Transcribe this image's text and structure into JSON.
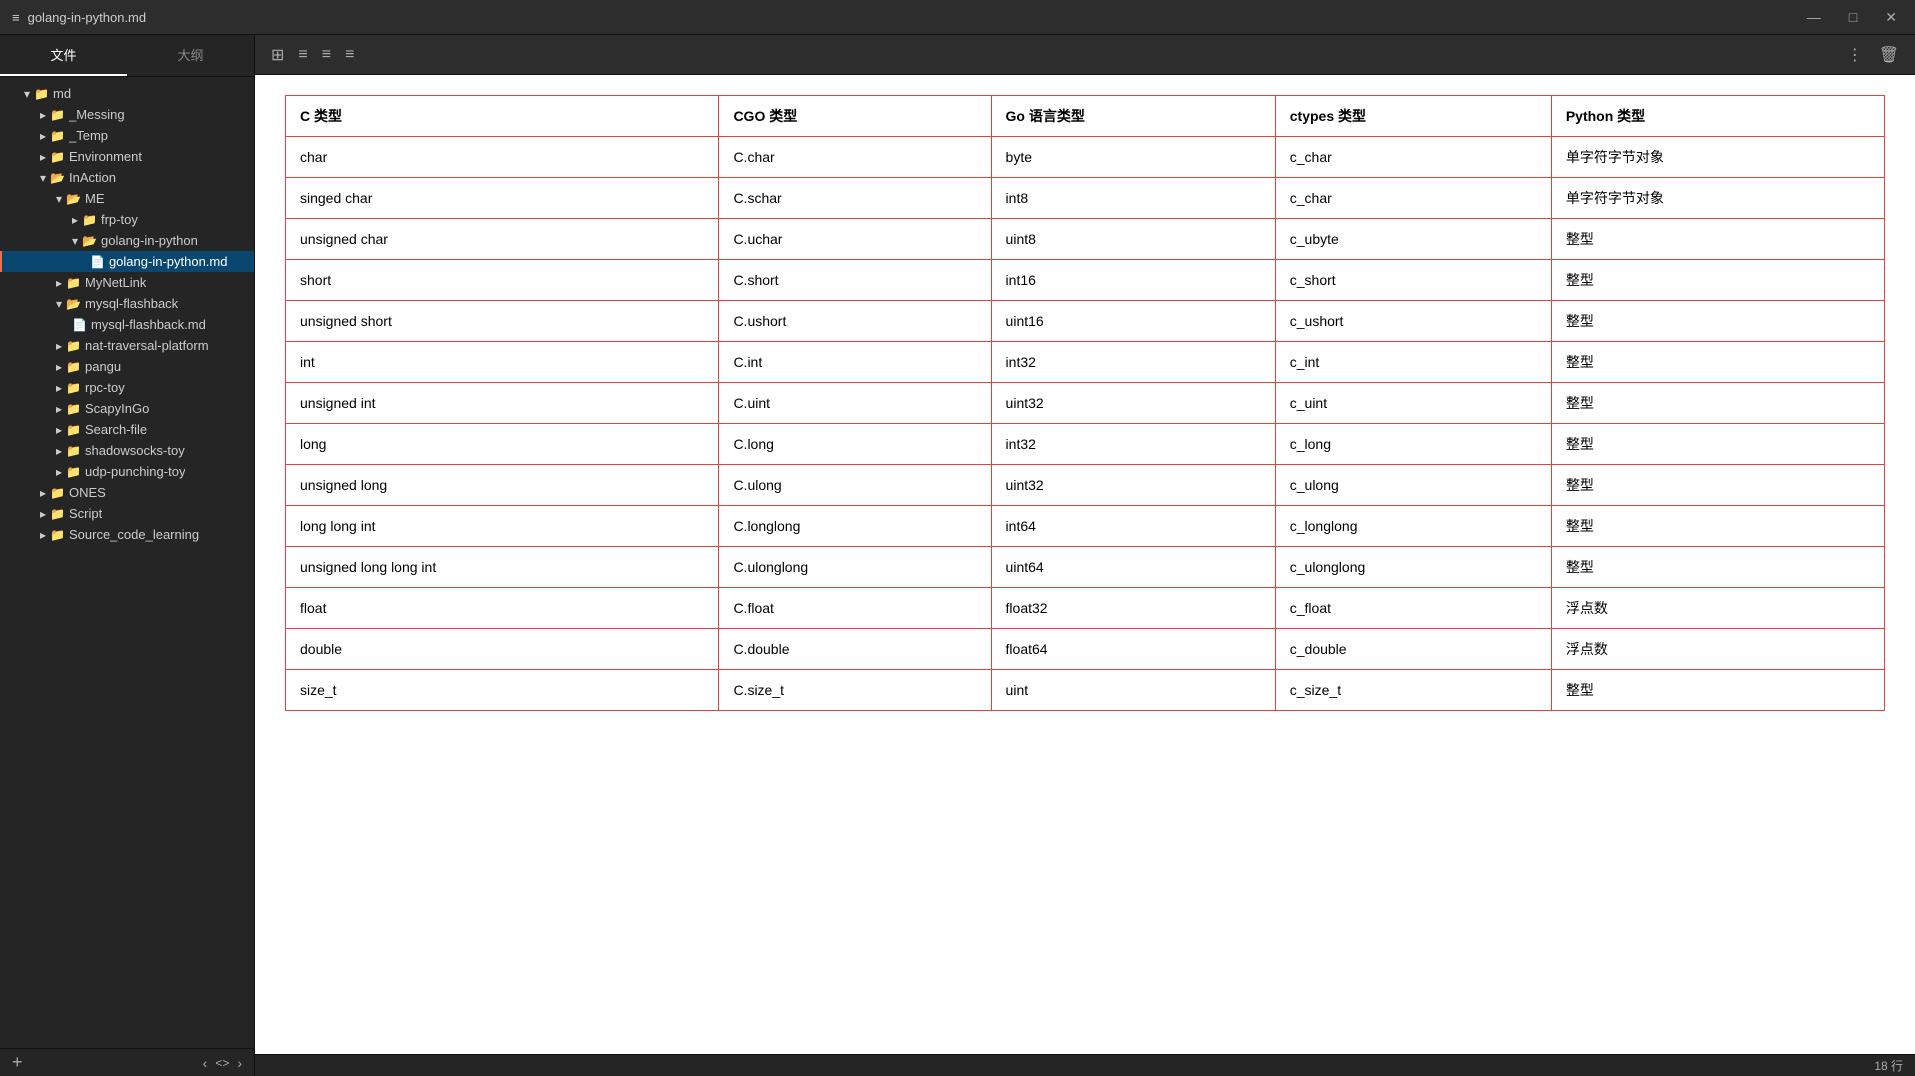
{
  "titleBar": {
    "title": "golang-in-python.md",
    "icon": "≡",
    "minBtn": "—",
    "maxBtn": "□",
    "closeBtn": "✕"
  },
  "sidebar": {
    "tab1": "文件",
    "tab2": "大纲",
    "rootItem": "md",
    "items": [
      {
        "id": "messing",
        "label": "_Messing",
        "indent": 1,
        "type": "folder",
        "expanded": false
      },
      {
        "id": "temp",
        "label": "_Temp",
        "indent": 1,
        "type": "folder",
        "expanded": false
      },
      {
        "id": "environment",
        "label": "Environment",
        "indent": 1,
        "type": "folder",
        "expanded": false
      },
      {
        "id": "inaction",
        "label": "InAction",
        "indent": 1,
        "type": "folder",
        "expanded": true
      },
      {
        "id": "me",
        "label": "ME",
        "indent": 2,
        "type": "folder",
        "expanded": true
      },
      {
        "id": "frp-toy",
        "label": "frp-toy",
        "indent": 3,
        "type": "folder",
        "expanded": false
      },
      {
        "id": "golang-in-python",
        "label": "golang-in-python",
        "indent": 3,
        "type": "folder",
        "expanded": true
      },
      {
        "id": "golang-in-python-md",
        "label": "golang-in-python.md",
        "indent": 4,
        "type": "file",
        "active": true
      },
      {
        "id": "mynetlink",
        "label": "MyNetLink",
        "indent": 2,
        "type": "folder",
        "expanded": false
      },
      {
        "id": "mysql-flashback",
        "label": "mysql-flashback",
        "indent": 2,
        "type": "folder",
        "expanded": true
      },
      {
        "id": "mysql-flashback-md",
        "label": "mysql-flashback.md",
        "indent": 3,
        "type": "file"
      },
      {
        "id": "nat-traversal",
        "label": "nat-traversal-platform",
        "indent": 2,
        "type": "folder",
        "expanded": false
      },
      {
        "id": "pangu",
        "label": "pangu",
        "indent": 2,
        "type": "folder",
        "expanded": false
      },
      {
        "id": "rpc-toy",
        "label": "rpc-toy",
        "indent": 2,
        "type": "folder",
        "expanded": false
      },
      {
        "id": "scapyingo",
        "label": "ScapyInGo",
        "indent": 2,
        "type": "folder",
        "expanded": false
      },
      {
        "id": "search-file",
        "label": "Search-file",
        "indent": 2,
        "type": "folder",
        "expanded": false
      },
      {
        "id": "shadowsocks-toy",
        "label": "shadowsocks-toy",
        "indent": 2,
        "type": "folder",
        "expanded": false
      },
      {
        "id": "udp-punching",
        "label": "udp-punching-toy",
        "indent": 2,
        "type": "folder",
        "expanded": false
      },
      {
        "id": "ones",
        "label": "ONES",
        "indent": 1,
        "type": "folder",
        "expanded": false
      },
      {
        "id": "script",
        "label": "Script",
        "indent": 1,
        "type": "folder",
        "expanded": false
      },
      {
        "id": "source-code",
        "label": "Source_code_learning",
        "indent": 1,
        "type": "folder",
        "expanded": false
      }
    ]
  },
  "toolbar": {
    "gridIcon": "⊞",
    "listIcon1": "≡",
    "listIcon2": "≡",
    "listIcon3": "≡",
    "moreIcon": "⋮",
    "deleteIcon": "🗑"
  },
  "table": {
    "headers": [
      "C 类型",
      "CGO 类型",
      "Go 语言类型",
      "ctypes 类型",
      "Python 类型"
    ],
    "rows": [
      [
        "char",
        "C.char",
        "byte",
        "c_char",
        "单字符字节对象"
      ],
      [
        "singed char",
        "C.schar",
        "int8",
        "c_char",
        "单字符字节对象"
      ],
      [
        "unsigned char",
        "C.uchar",
        "uint8",
        "c_ubyte",
        "整型"
      ],
      [
        "short",
        "C.short",
        "int16",
        "c_short",
        "整型"
      ],
      [
        "unsigned short",
        "C.ushort",
        "uint16",
        "c_ushort",
        "整型"
      ],
      [
        "int",
        "C.int",
        "int32",
        "c_int",
        "整型"
      ],
      [
        "unsigned int",
        "C.uint",
        "uint32",
        "c_uint",
        "整型"
      ],
      [
        "long",
        "C.long",
        "int32",
        "c_long",
        "整型"
      ],
      [
        "unsigned long",
        "C.ulong",
        "uint32",
        "c_ulong",
        "整型"
      ],
      [
        "long long int",
        "C.longlong",
        "int64",
        "c_longlong",
        "整型"
      ],
      [
        "unsigned long long int",
        "C.ulonglong",
        "uint64",
        "c_ulonglong",
        "整型"
      ],
      [
        "float",
        "C.float",
        "float32",
        "c_float",
        "浮点数"
      ],
      [
        "double",
        "C.double",
        "float64",
        "c_double",
        "浮点数"
      ],
      [
        "size_t",
        "C.size_t",
        "uint",
        "c_size_t",
        "整型"
      ]
    ]
  },
  "statusBar": {
    "lines": "18 行"
  },
  "bottomBar": {
    "addLabel": "+",
    "navBack": "‹",
    "navForward": "›",
    "codeToggle": "<>"
  }
}
